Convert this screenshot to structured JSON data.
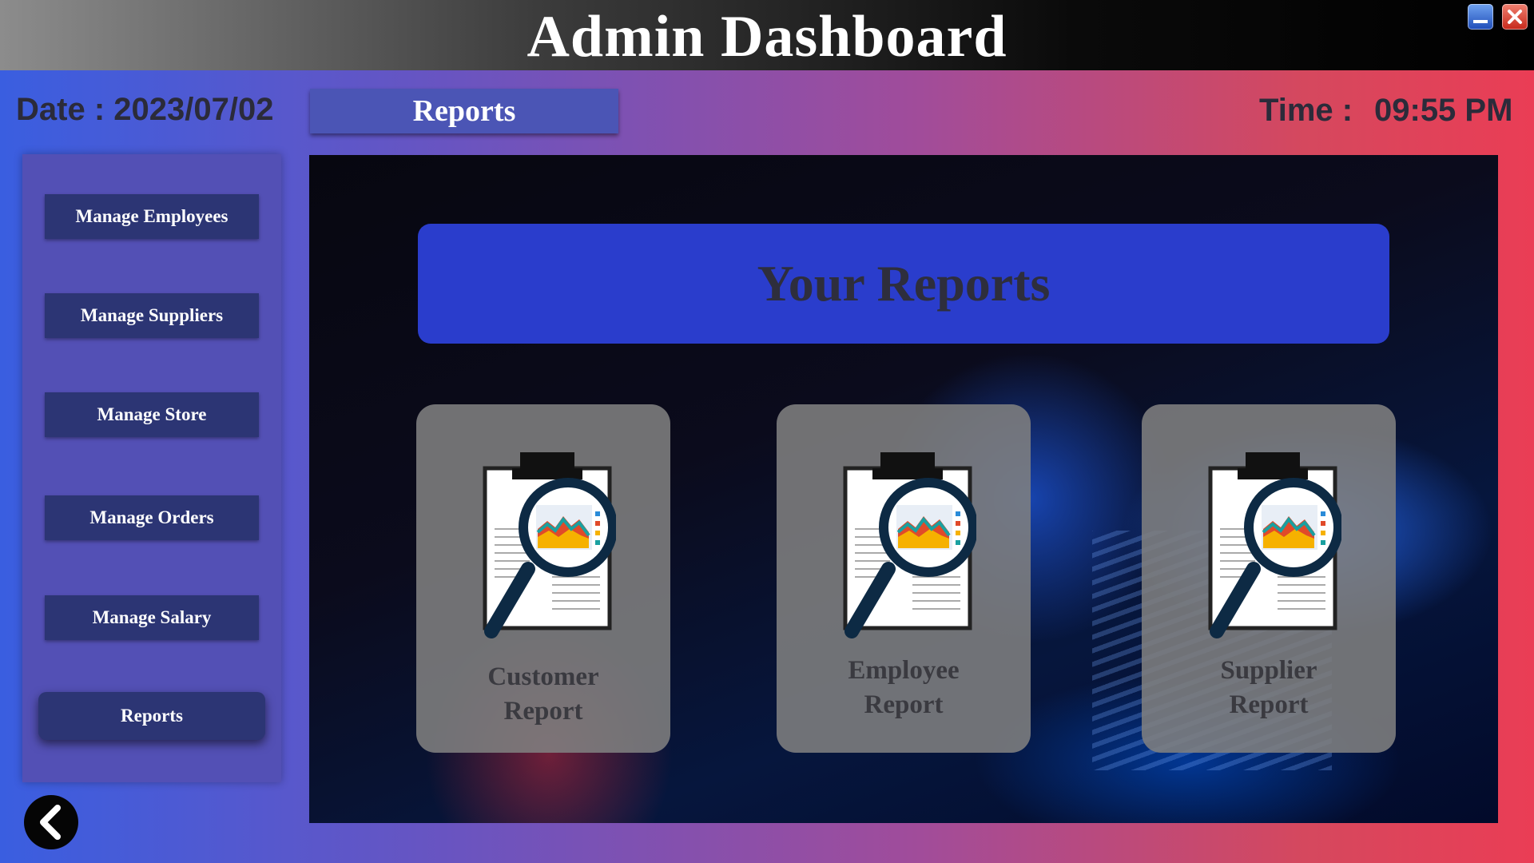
{
  "window": {
    "title": "Admin Dashboard",
    "minimize_icon": "minimize-icon",
    "close_icon": "close-icon"
  },
  "header": {
    "date": "Date : 2023/07/02",
    "section": "Reports",
    "time_label": "Time :",
    "time_value": "09:55 PM"
  },
  "sidebar": {
    "items": [
      {
        "label": "Manage Employees"
      },
      {
        "label": "Manage Suppliers"
      },
      {
        "label": "Manage Store"
      },
      {
        "label": "Manage Orders"
      },
      {
        "label": "Manage Salary"
      },
      {
        "label": "Reports",
        "active": true
      }
    ]
  },
  "back_button": {
    "icon": "chevron-left-icon"
  },
  "main": {
    "banner": "Your Reports",
    "cards": [
      {
        "line1": "Customer",
        "line2": "Report",
        "icon": "report-search-icon"
      },
      {
        "line1": "Employee",
        "line2": "Report",
        "icon": "report-search-icon"
      },
      {
        "line1": "Supplier",
        "line2": "Report",
        "icon": "report-search-icon"
      }
    ]
  },
  "colors": {
    "accent_blue": "#2a3dcc",
    "nav_button": "#2c3574",
    "sidebar": "#5350b5"
  }
}
